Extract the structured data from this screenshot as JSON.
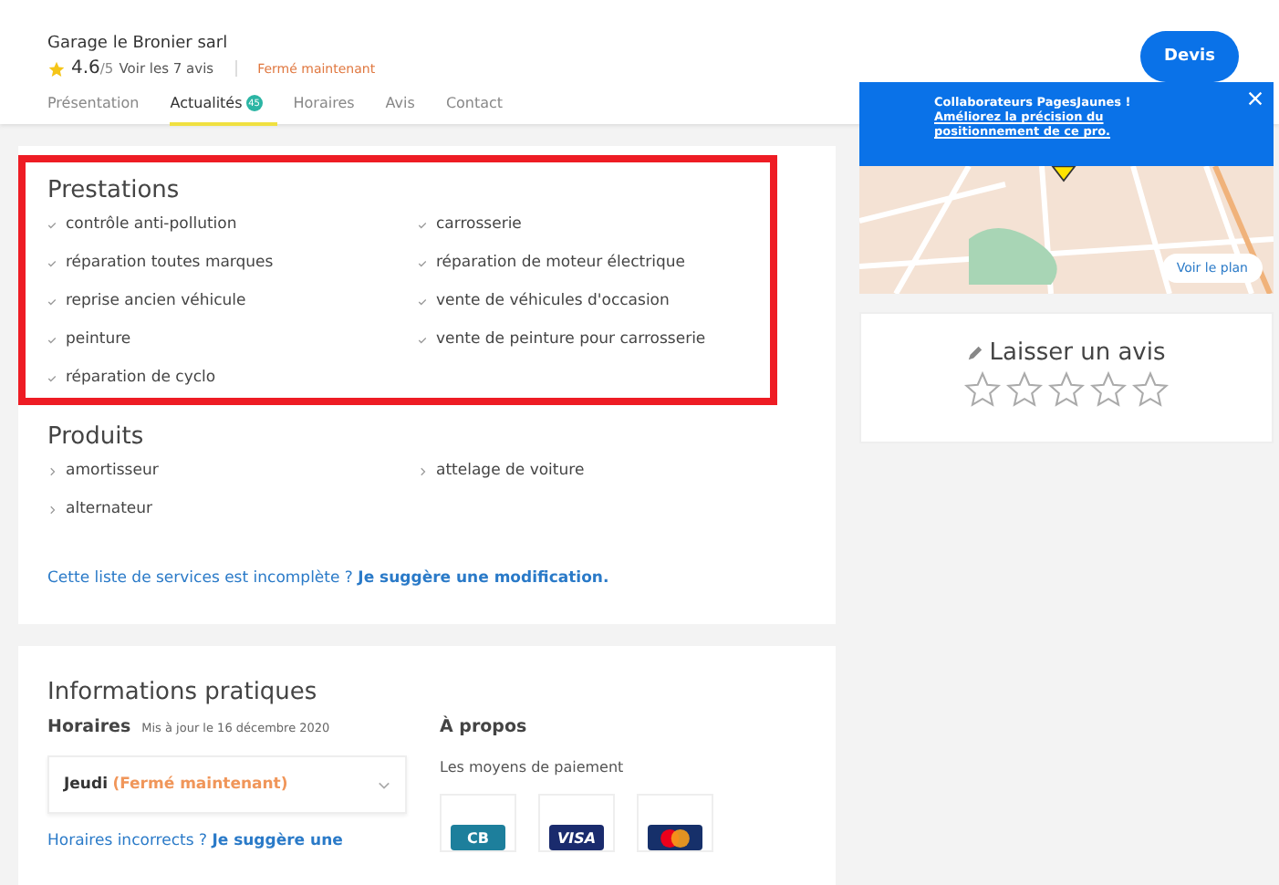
{
  "business": {
    "name": "Garage le Bronier sarl",
    "rating": "4.6",
    "rating_scale": "/5",
    "reviews_link": "Voir les 7 avis",
    "status": "Fermé maintenant"
  },
  "quote_button": "Devis",
  "tabs": [
    {
      "label": "Présentation",
      "selected": false
    },
    {
      "label": "Actualités",
      "selected": true,
      "badge": "45"
    },
    {
      "label": "Horaires",
      "selected": false
    },
    {
      "label": "Avis",
      "selected": false
    },
    {
      "label": "Contact",
      "selected": false
    }
  ],
  "prestations": {
    "title": "Prestations",
    "highlighted": true,
    "items": [
      "contrôle anti-pollution",
      "réparation toutes marques",
      "reprise ancien véhicule",
      "peinture",
      "réparation de cyclo",
      "carrosserie",
      "réparation de moteur électrique",
      "vente de véhicules d'occasion",
      "vente de peinture pour carrosserie"
    ]
  },
  "produits": {
    "title": "Produits",
    "items": [
      "amortisseur",
      "alternateur",
      "attelage de voiture"
    ]
  },
  "suggestion": {
    "text": "Cette liste de services est incomplète ?",
    "link": "Je suggère une modification."
  },
  "info": {
    "title": "Informations pratiques",
    "hours_title": "Horaires",
    "hours_updated": "Mis à jour le 16 décembre 2020",
    "day": "Jeudi",
    "day_status": "(Fermé maintenant)",
    "hours_text": "Horaires incorrects ?",
    "hours_link": "Je suggère une",
    "about_title": "À propos",
    "payment_title": "Les moyens de paiement",
    "payments": [
      {
        "kind": "cb",
        "label": "CB"
      },
      {
        "kind": "visa",
        "label": "VISA"
      },
      {
        "kind": "mastercard"
      }
    ]
  },
  "map_banner": {
    "title": "Collaborateurs PagesJaunes !",
    "link": "Améliorez la précision du positionnement de ce pro."
  },
  "map_button": "Voir le plan",
  "review": {
    "title": "Laisser un avis",
    "stars": 0
  }
}
